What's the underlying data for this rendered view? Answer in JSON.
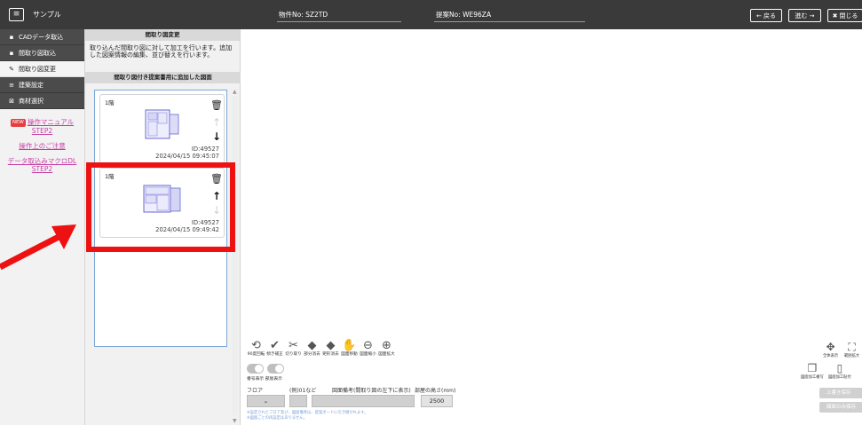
{
  "header": {
    "app_title": "サンプル",
    "property_label": "物件No: SZ2TD",
    "proposal_label": "提案No: WE96ZA",
    "back_label": "← 戻る",
    "forward_label": "進む →",
    "close_label": "閉じる"
  },
  "sidebar": {
    "items": [
      {
        "icon": "▪",
        "label": "CADデータ取込"
      },
      {
        "icon": "▪",
        "label": "間取り図取込"
      },
      {
        "icon": "✎",
        "label": "間取り図変更"
      },
      {
        "icon": "≡",
        "label": "建築設定"
      },
      {
        "icon": "⊠",
        "label": "商材選択"
      }
    ],
    "new_badge": "NEW",
    "manual_link": "操作マニュアル STEP2",
    "notes_link": "操作上のご注意",
    "macro_link": "データ取込みマクロDL STEP2"
  },
  "panel": {
    "title": "間取り図変更",
    "description": "取り込んだ間取り図に対して加工を行います。追加した図案情報の編集、並び替えを行います。",
    "list_title": "間取り図付き提案書用に追加した図面"
  },
  "cards": [
    {
      "floor": "1階",
      "id": "ID:49527",
      "datetime": "2024/04/15 09:45:07"
    },
    {
      "floor": "1階",
      "id": "ID:49527",
      "datetime": "2024/04/15 09:49:42"
    }
  ],
  "toolbar": {
    "tools": [
      {
        "icon": "rotate-icon",
        "glyph": "⟲",
        "label": "90度回転"
      },
      {
        "icon": "check-icon",
        "glyph": "✔",
        "label": "傾き補正"
      },
      {
        "icon": "scissors-icon",
        "glyph": "✂",
        "label": "切り取り"
      },
      {
        "icon": "eraser-icon",
        "glyph": "◆",
        "label": "部分消去"
      },
      {
        "icon": "eraser-rect-icon",
        "glyph": "◆",
        "label": "矩形消去"
      },
      {
        "icon": "hand-icon",
        "glyph": "✋",
        "label": "図面移動"
      },
      {
        "icon": "zoom-out-icon",
        "glyph": "⊖",
        "label": "図面縮小"
      },
      {
        "icon": "zoom-in-icon",
        "glyph": "⊕",
        "label": "図面拡大"
      }
    ],
    "toggle_labels": [
      "番号表示",
      "部屋表示"
    ],
    "floor_label": "フロア",
    "example_label": "(例)01など",
    "drawing_note_label": "図面備考(間取り図の左下に表示)",
    "room_height_label": "部屋の高さ(mm)",
    "room_height_value": "2500",
    "note_line1": "※設定されたフロア及び、図面備考は、提案ボードに引き継がれます。",
    "note_line2": "※図面ごとの再設定はありません。",
    "fit_label": "全体表示",
    "range_label": "範囲拡大",
    "copy_label": "図面加工複写",
    "paste_label": "図面加工貼付",
    "save_button": "上書き保存",
    "save_only_button": "図面のみ保存"
  },
  "colors": {
    "highlight": "#ee1111",
    "accent_link": "#c83fa5",
    "topbar": "#3a3a3a"
  }
}
